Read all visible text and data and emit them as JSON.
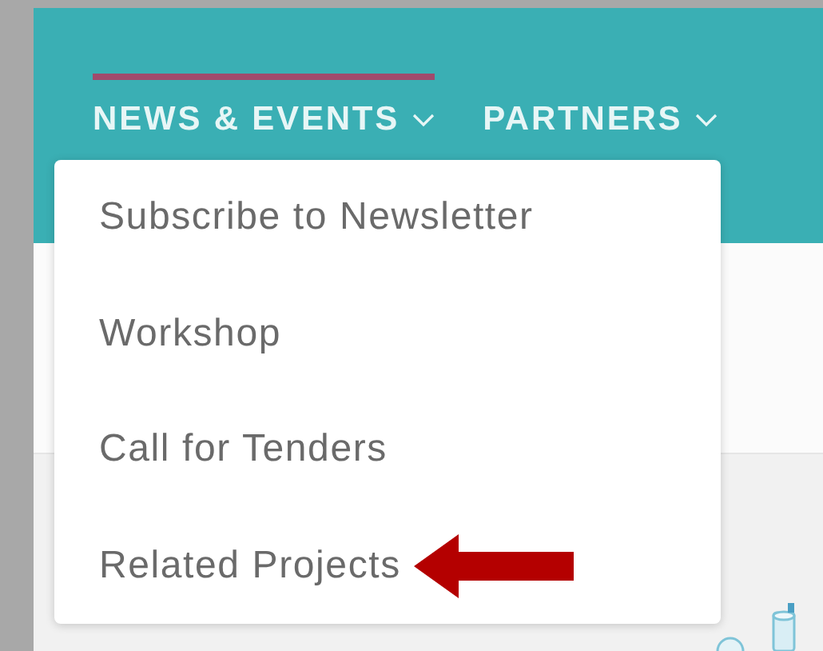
{
  "nav": [
    {
      "label": "NEWS & EVENTS",
      "selected": true,
      "menu": [
        {
          "label": "Subscribe to Newsletter",
          "pointed": false
        },
        {
          "label": "Workshop",
          "pointed": false
        },
        {
          "label": "Call for Tenders",
          "pointed": false
        },
        {
          "label": "Related Projects",
          "pointed": true
        }
      ]
    },
    {
      "label": "PARTNERS",
      "selected": false
    }
  ]
}
